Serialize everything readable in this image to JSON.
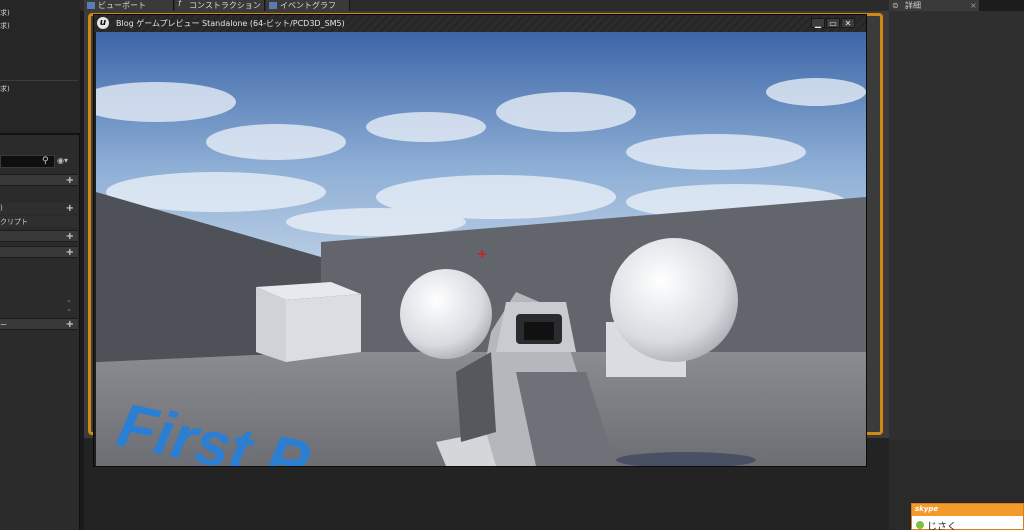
{
  "editor": {
    "tabs": [
      {
        "label": "ビューポート"
      },
      {
        "label": "コンストラクション"
      },
      {
        "label": "イベントグラフ"
      }
    ],
    "left_panel": {
      "line1": "求)",
      "line2": "求)",
      "line3": "求)",
      "header_item": ")",
      "script_label": "クリプト",
      "bottom_header": "ー"
    },
    "details_tab": "詳細",
    "close_glyph": "×"
  },
  "game_window": {
    "logo": "u",
    "title": "Blog ゲームプレビュー Standalone (64-ビット/PCD3D_SM5)",
    "min_glyph": "▁",
    "max_glyph": "▭",
    "close_glyph": "✕",
    "floor_text": "First P",
    "colors": {
      "sky_top": "#3d66a8",
      "sky_bottom": "#b9cde4",
      "wall": "#5c5f66",
      "floor": "#7b7d83",
      "floor_text": "#2a7fd2",
      "crosshair": "#cc2222"
    }
  },
  "skype": {
    "brand": "skype",
    "contact": "じさく",
    "status_color": "#7cc242"
  }
}
